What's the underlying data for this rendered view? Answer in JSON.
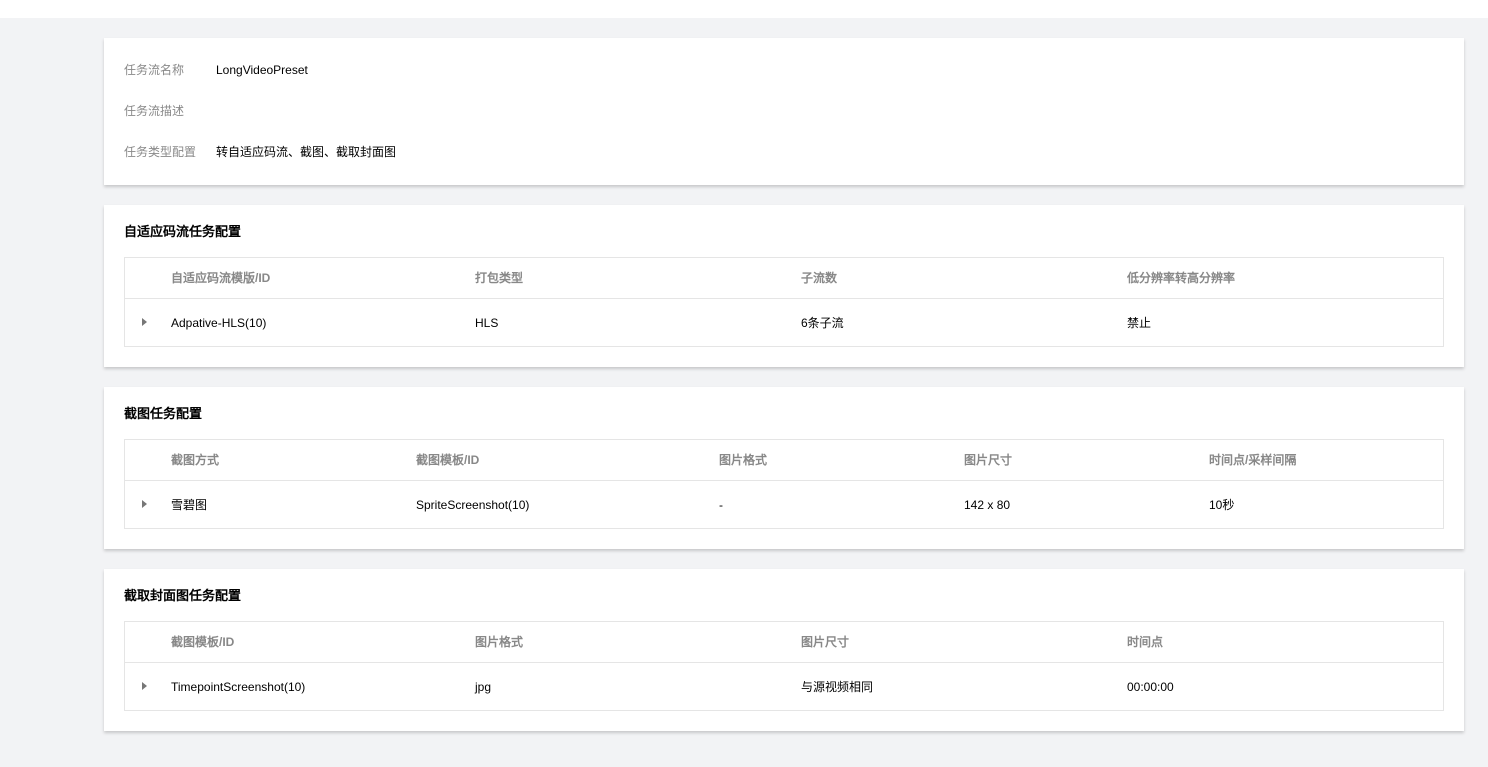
{
  "info": {
    "name_label": "任务流名称",
    "name_value": "LongVideoPreset",
    "desc_label": "任务流描述",
    "desc_value": "",
    "type_label": "任务类型配置",
    "type_value": "转自适应码流、截图、截取封面图"
  },
  "adaptive": {
    "title": "自适应码流任务配置",
    "columns": [
      "自适应码流模版/ID",
      "打包类型",
      "子流数",
      "低分辨率转高分辨率"
    ],
    "row": [
      "Adpative-HLS(10)",
      "HLS",
      "6条子流",
      "禁止"
    ]
  },
  "snapshot": {
    "title": "截图任务配置",
    "columns": [
      "截图方式",
      "截图模板/ID",
      "图片格式",
      "图片尺寸",
      "时间点/采样间隔"
    ],
    "row": [
      "雪碧图",
      "SpriteScreenshot(10)",
      "-",
      "142 x 80",
      "10秒"
    ]
  },
  "cover": {
    "title": "截取封面图任务配置",
    "columns": [
      "截图模板/ID",
      "图片格式",
      "图片尺寸",
      "时间点"
    ],
    "row": [
      "TimepointScreenshot(10)",
      "jpg",
      "与源视频相同",
      "00:00:00"
    ]
  },
  "icons": {
    "expand": "caret-right-icon"
  }
}
